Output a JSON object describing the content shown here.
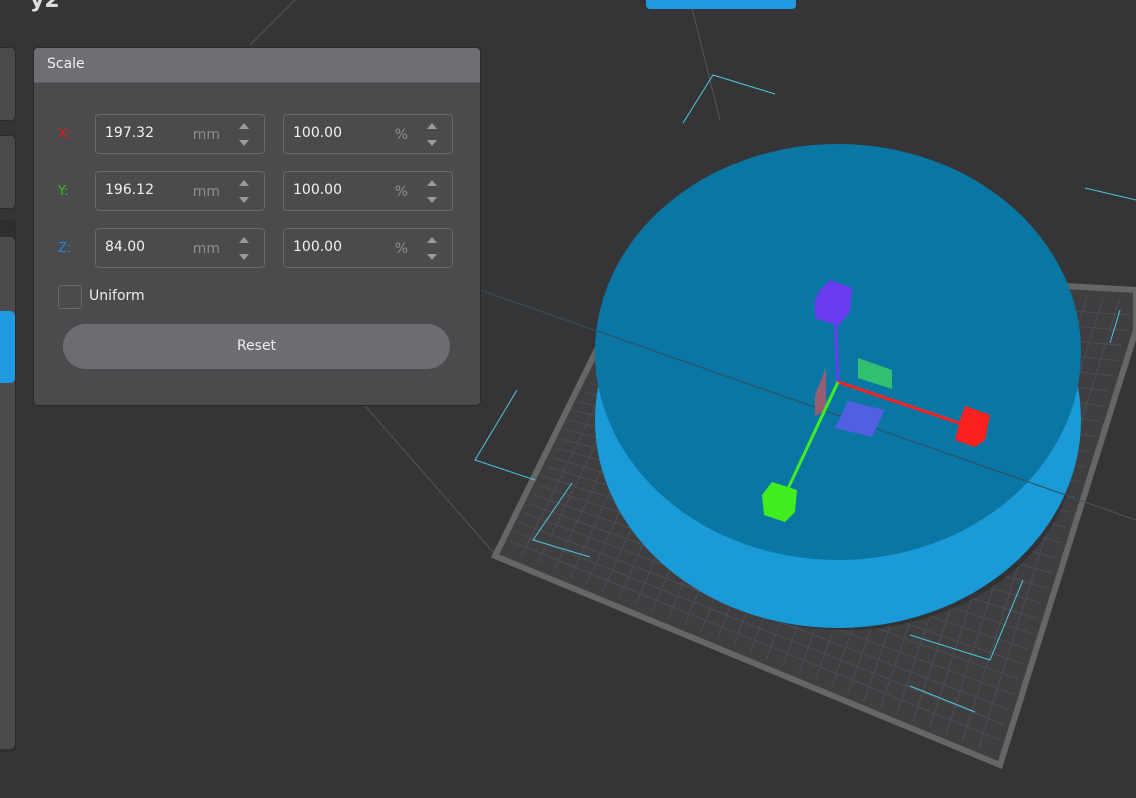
{
  "title_fragment": "y2",
  "scale_panel": {
    "title": "Scale",
    "rows": [
      {
        "axis": "X:",
        "color": "#e11b1b",
        "size": "197.32",
        "size_unit": "mm",
        "percent": "100.00",
        "percent_unit": "%"
      },
      {
        "axis": "Y:",
        "color": "#29c41f",
        "size": "196.12",
        "size_unit": "mm",
        "percent": "100.00",
        "percent_unit": "%"
      },
      {
        "axis": "Z:",
        "color": "#2a82dc",
        "size": "84.00",
        "size_unit": "mm",
        "percent": "100.00",
        "percent_unit": "%"
      }
    ],
    "uniform_label": "Uniform",
    "uniform_checked": false,
    "reset_label": "Reset"
  },
  "colors": {
    "accent": "#1e9be2",
    "model_top": "#0a76a3",
    "model_side": "#1a9ad6"
  }
}
